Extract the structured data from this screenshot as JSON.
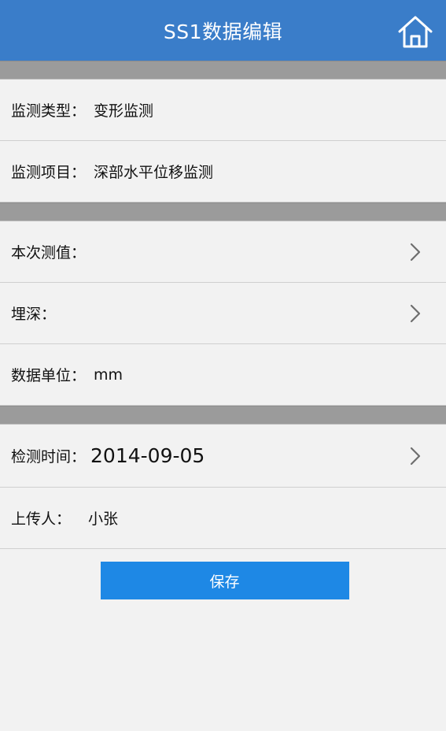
{
  "header": {
    "title": "SS1数据编辑",
    "home_icon": "home-icon",
    "color": "#3a7dc9"
  },
  "section1": {
    "monitor_type_label": "监测类型：",
    "monitor_type_value": "变形监测",
    "monitor_item_label": "监测项目：",
    "monitor_item_value": "深部水平位移监测"
  },
  "section2": {
    "current_value_label": "本次测值：",
    "current_value": "",
    "depth_label": "埋深：",
    "depth_value": "",
    "unit_label": "数据单位：",
    "unit_value": "mm"
  },
  "section3": {
    "time_label": "检测时间：",
    "time_value": "2014-09-05",
    "uploader_label": "上传人：",
    "uploader_value": "小张"
  },
  "actions": {
    "save_label": "保存",
    "save_color": "#1e88e5"
  },
  "icons": {
    "chevron": "chevron-right-icon"
  }
}
